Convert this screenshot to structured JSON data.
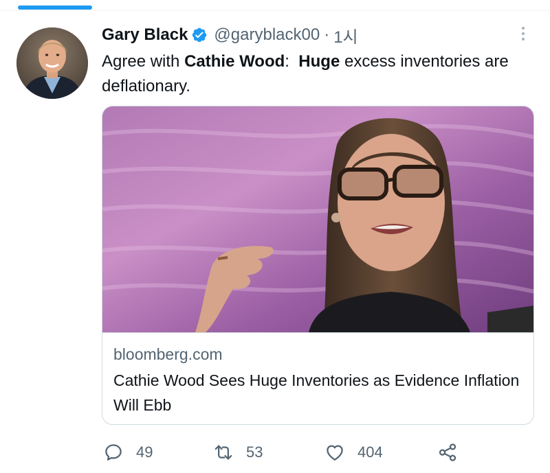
{
  "tweet": {
    "author": {
      "display_name": "Gary Black",
      "handle": "@garyblack00",
      "verified": true
    },
    "separator": "·",
    "timestamp": "1시",
    "text": {
      "part1": "Agree with ",
      "bold1": "Cathie Wood",
      "part2": ":  ",
      "bold2": "Huge",
      "part3": " excess inventories are deflationary."
    },
    "card": {
      "domain": "bloomberg.com",
      "title": "Cathie Wood Sees Huge Inventories as Evidence Inflation Will Ebb"
    },
    "actions": {
      "reply_count": "49",
      "retweet_count": "53",
      "like_count": "404"
    }
  },
  "colors": {
    "accent": "#1d9bf0",
    "text_primary": "#0f1419",
    "text_secondary": "#536471",
    "border": "#cfd9de"
  },
  "icons": [
    "verified-icon",
    "more-icon",
    "reply-icon",
    "retweet-icon",
    "like-icon",
    "share-icon"
  ]
}
